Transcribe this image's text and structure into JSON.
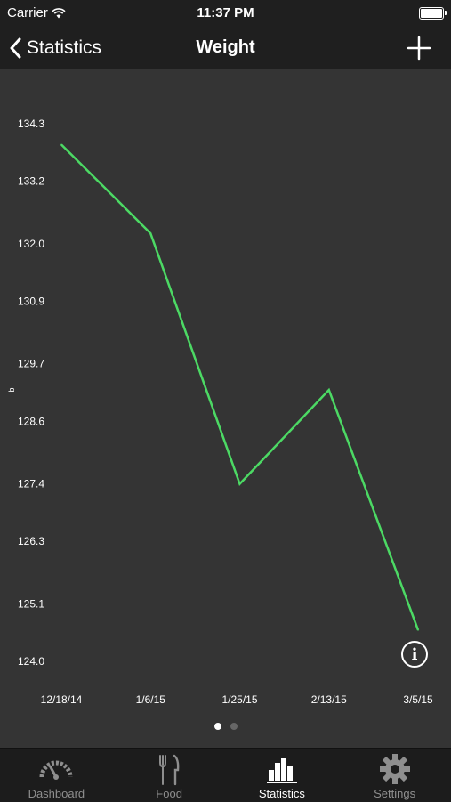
{
  "status_bar": {
    "carrier": "Carrier",
    "time": "11:37 PM"
  },
  "nav": {
    "back_label": "Statistics",
    "title": "Weight"
  },
  "chart_data": {
    "type": "line",
    "title": "",
    "ylabel": "lb",
    "xlabel": "",
    "x_ticks": [
      "12/18/14",
      "1/6/15",
      "1/25/15",
      "2/13/15",
      "3/5/15"
    ],
    "y_ticks": [
      "134.3",
      "133.2",
      "132.0",
      "130.9",
      "129.7",
      "128.6",
      "127.4",
      "126.3",
      "125.1",
      "124.0"
    ],
    "ylim": [
      124.0,
      134.3
    ],
    "series": [
      {
        "color": "#4cd964",
        "x": [
          "12/18/14",
          "1/6/15",
          "1/25/15",
          "2/13/15",
          "3/5/15"
        ],
        "values": [
          133.9,
          132.2,
          127.4,
          129.2,
          124.6
        ]
      }
    ],
    "grid": false
  },
  "page_indicator": {
    "count": 2,
    "active": 0
  },
  "tabs": [
    {
      "label": "Dashboard",
      "icon": "speedometer-icon",
      "active": false
    },
    {
      "label": "Food",
      "icon": "fork-knife-icon",
      "active": false
    },
    {
      "label": "Statistics",
      "icon": "bar-chart-icon",
      "active": true
    },
    {
      "label": "Settings",
      "icon": "gear-icon",
      "active": false
    }
  ],
  "colors": {
    "background": "#343434",
    "bar_background": "#1f1f1f",
    "line": "#4cd964",
    "tab_inactive": "#8e8e8e",
    "tab_active": "#ffffff"
  }
}
